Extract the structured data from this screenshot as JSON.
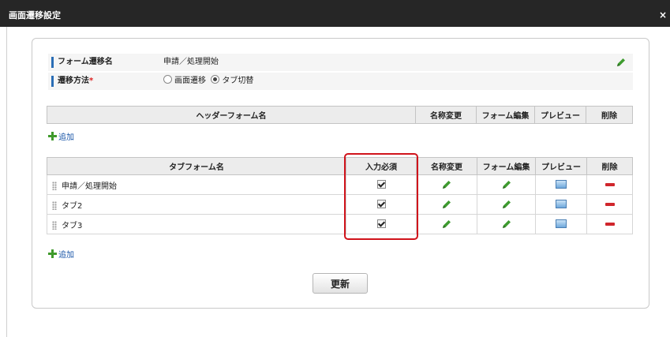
{
  "dialog": {
    "title": "画面遷移設定",
    "close_label": "×"
  },
  "form_info": {
    "form_transition_name_label": "フォーム遷移名",
    "form_transition_name_value": "申請／処理開始",
    "method_label": "遷移方法",
    "method_required_mark": "*",
    "method_options": [
      "画面遷移",
      "タブ切替"
    ],
    "method_selected": "タブ切替"
  },
  "header_table": {
    "columns": [
      "ヘッダーフォーム名",
      "名称変更",
      "フォーム編集",
      "プレビュー",
      "削除"
    ]
  },
  "header_add_label": "追加",
  "tab_table": {
    "columns": [
      "タブフォーム名",
      "入力必須",
      "名称変更",
      "フォーム編集",
      "プレビュー",
      "削除"
    ],
    "rows": [
      {
        "name": "申請／処理開始",
        "required": true
      },
      {
        "name": "タブ2",
        "required": true
      },
      {
        "name": "タブ3",
        "required": true
      }
    ]
  },
  "tab_add_label": "追加",
  "update_button_label": "更新",
  "colors": {
    "accent_blue": "#2a6db5",
    "highlight_red": "#d0131b",
    "add_green": "#3f9a2c",
    "delete_red": "#d0262c"
  }
}
